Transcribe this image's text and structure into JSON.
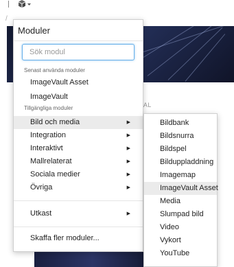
{
  "toolbar": {
    "module_icon": "module-cube-icon",
    "dropdown_icon": "caret-down-icon",
    "path_glyph": "/"
  },
  "background": {
    "visual_label": "UAL"
  },
  "menu": {
    "title": "Moduler",
    "search_placeholder": "Sök modul",
    "recent_label": "Senast använda moduler",
    "recent_items": [
      "ImageVault Asset",
      "ImageVault"
    ],
    "available_label": "Tillgängliga moduler",
    "categories": [
      {
        "label": "Bild och media"
      },
      {
        "label": "Integration"
      },
      {
        "label": "Interaktivt"
      },
      {
        "label": "Mallrelaterat"
      },
      {
        "label": "Sociala medier"
      },
      {
        "label": "Övriga"
      }
    ],
    "drafts_label": "Utkast",
    "get_more_label": "Skaffa fler moduler..."
  },
  "submenu": {
    "items": [
      "Bildbank",
      "Bildsnurra",
      "Bildspel",
      "Bilduppladdning",
      "Imagemap",
      "ImageVault Asset",
      "Media",
      "Slumpad bild",
      "Video",
      "Vykort",
      "YouTube"
    ]
  },
  "colors": {
    "highlight": "#ebebeb",
    "focus_border": "#66afe9",
    "hero": "#1b2446"
  }
}
